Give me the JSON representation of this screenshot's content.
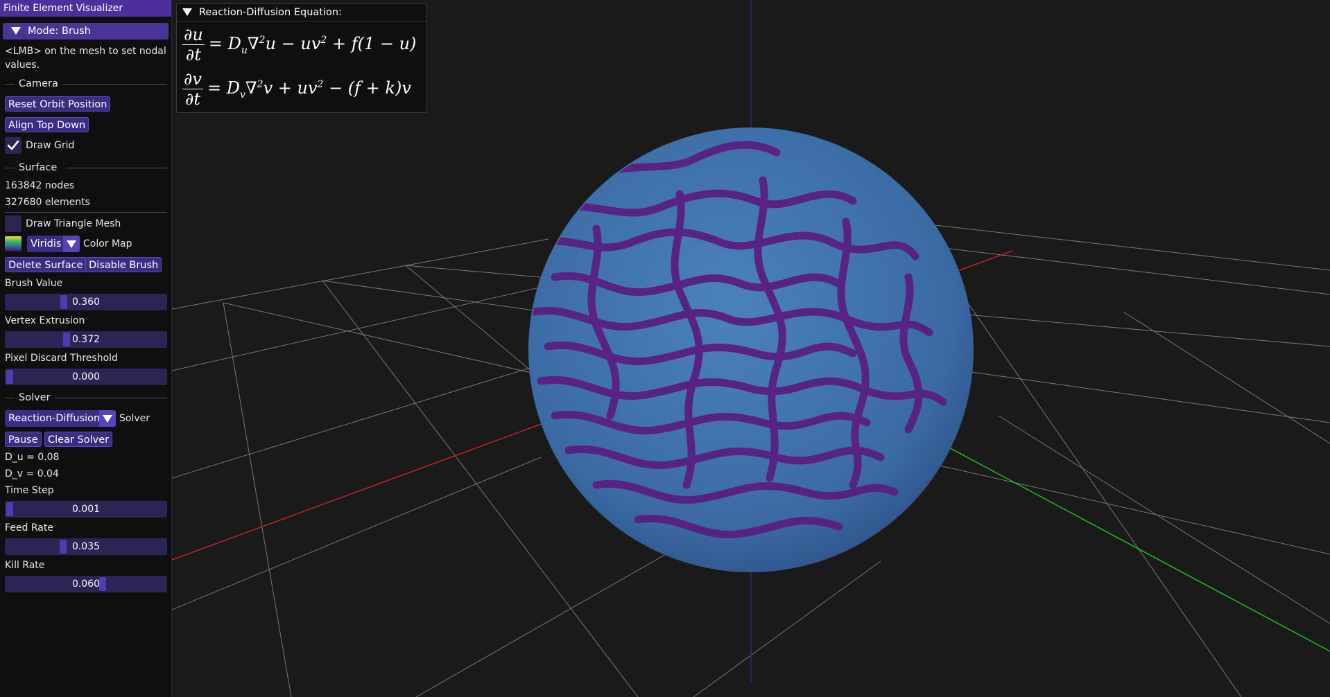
{
  "window": {
    "title": "Finite Element Visualizer"
  },
  "mode": {
    "label": "Mode: Brush",
    "hint": "<LMB> on the mesh to set nodal values."
  },
  "camera": {
    "header": "Camera",
    "reset_orbit_label": "Reset Orbit Position",
    "align_top_down_label": "Align Top Down",
    "draw_grid_label": "Draw Grid",
    "draw_grid_checked": true
  },
  "surface": {
    "header": "Surface",
    "nodes_text": "163842 nodes",
    "elements_text": "327680 elements",
    "draw_triangle_mesh_label": "Draw Triangle Mesh",
    "draw_triangle_mesh_checked": false,
    "colormap_value": "Viridis",
    "colormap_label": "Color Map",
    "delete_surface_label": "Delete Surface",
    "disable_brush_label": "Disable Brush",
    "brush_value_label": "Brush Value",
    "brush_value": "0.360",
    "brush_value_fraction": 0.36,
    "vertex_extrusion_label": "Vertex Extrusion",
    "vertex_extrusion": "0.372",
    "vertex_extrusion_fraction": 0.372,
    "pixel_discard_label": "Pixel Discard Threshold",
    "pixel_discard": "0.000",
    "pixel_discard_fraction": 0.0
  },
  "solver": {
    "header": "Solver",
    "solver_type": "Reaction-Diffusion",
    "solver_label": "Solver",
    "pause_label": "Pause",
    "clear_label": "Clear Solver",
    "du_text": "D_u = 0.08",
    "dv_text": "D_v = 0.04",
    "time_step_label": "Time Step",
    "time_step": "0.001",
    "time_step_fraction": 0.001,
    "feed_rate_label": "Feed Rate",
    "feed_rate": "0.035",
    "feed_rate_fraction": 0.35,
    "kill_rate_label": "Kill Rate",
    "kill_rate": "0.060",
    "kill_rate_fraction": 0.6
  },
  "equation_panel": {
    "title": "Reaction-Diffusion Equation:",
    "eq1_num": "∂u",
    "eq1_den": "∂t",
    "eq2_num": "∂v",
    "eq2_den": "∂t"
  },
  "colors": {
    "accent": "#4d2f9c",
    "button": "#3d2c86",
    "sphere_base": "#3f6ea8",
    "sphere_pattern": "#5a1f82",
    "grid_line": "#8a8a8a",
    "x_axis": "#c0242a",
    "y_axis": "#22c022"
  },
  "icons": [
    "collapse-triangle-icon",
    "checkmark-icon",
    "colormap-swatch-icon",
    "dropdown-arrow-icon"
  ]
}
